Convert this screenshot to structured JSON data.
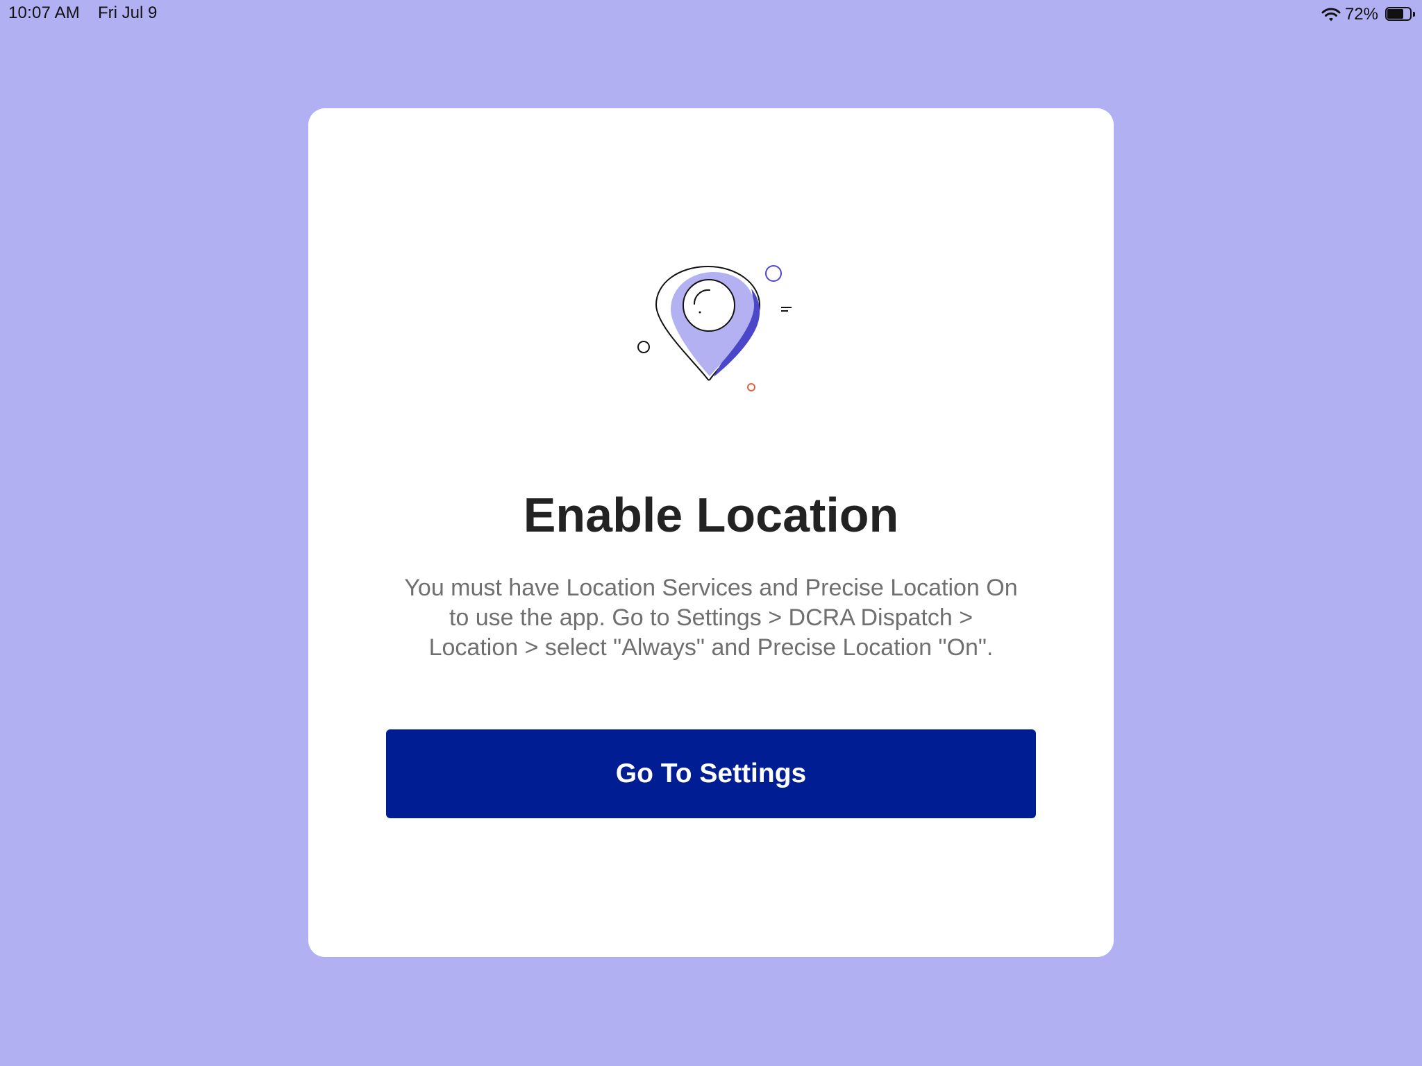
{
  "status_bar": {
    "time": "10:07 AM",
    "date": "Fri Jul 9",
    "battery_percent": "72%",
    "battery_level": 0.72,
    "icons": [
      "wifi-icon",
      "battery-icon"
    ]
  },
  "dialog": {
    "illustration_icon": "location-pin-icon",
    "title": "Enable Location",
    "message_lines": [
      "You must have Location Services and Precise Location On",
      "to use the app. Go to Settings > DCRA Dispatch >",
      "Location > select \"Always\" and Precise Location \"On\"."
    ],
    "button_label": "Go To Settings"
  },
  "colors": {
    "background": "#b1b0f2",
    "card": "#ffffff",
    "button": "#001d93",
    "button_text": "#ffffff",
    "title_text": "#222222",
    "body_text": "#6f6f6f",
    "pin_light": "#b3b1f1",
    "pin_dark": "#4c47c8",
    "accent_dot": "#e5603f"
  }
}
